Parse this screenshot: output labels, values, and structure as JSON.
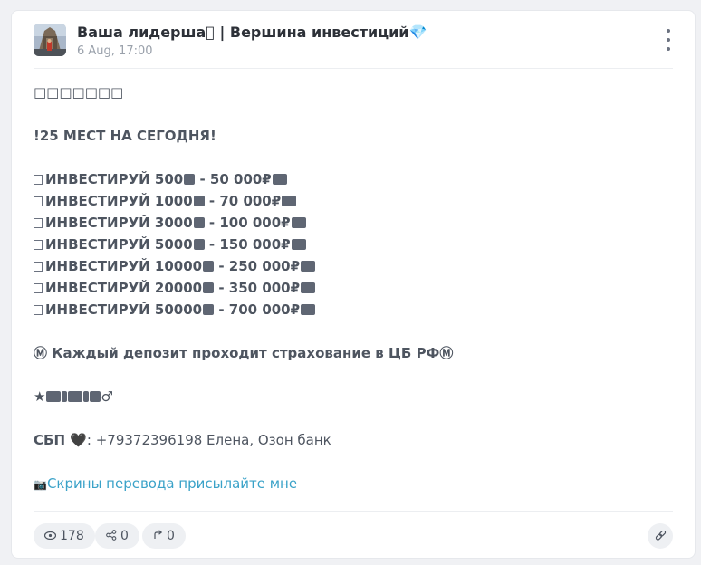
{
  "post": {
    "channel_name": "Ваша лидерша􀀀 | Вершина инвестиций💎",
    "date": "6 Aug, 17:00",
    "body": {
      "line_boxes": "□□□□□□□",
      "headline": "!25 МЕСТ НА СЕГОДНЯ!",
      "offers": [
        "ИНВЕСТИРУЙ 500",
        "ИНВЕСТИРУЙ 1000",
        "ИНВЕСТИРУЙ 3000",
        "ИНВЕСТИРУЙ 5000",
        "ИНВЕСТИРУЙ 10000",
        "ИНВЕСТИРУЙ 20000",
        "ИНВЕСТИРУЙ 50000"
      ],
      "offer_returns": [
        " - 50 000₽",
        " - 70 000₽",
        " - 100 000₽",
        " - 150 000₽",
        " - 250 000₽",
        " - 350 000₽",
        " - 700 000₽"
      ],
      "insurance": "Ⓜ Каждый депозит проходит страхование в ЦБ РФⓂ",
      "symbols_line": "★",
      "sbp_label": "СБП 🖤",
      "sbp_details": ": +79372396198 Елена, Озон банк",
      "screens_icon": "📷",
      "screens_link": "Скрины перевода присылайте мне"
    },
    "stats": {
      "views": "178",
      "shares": "0",
      "forwards": "0"
    },
    "icons": {
      "views": "eye-icon",
      "shares": "share-icon",
      "forwards": "forward-arrow-icon",
      "link": "link-icon",
      "menu": "more-vertical-icon"
    },
    "colors": {
      "link": "#3aa2c8",
      "text": "#4e5560",
      "title": "#2d3138",
      "muted": "#9aa1ab"
    }
  }
}
